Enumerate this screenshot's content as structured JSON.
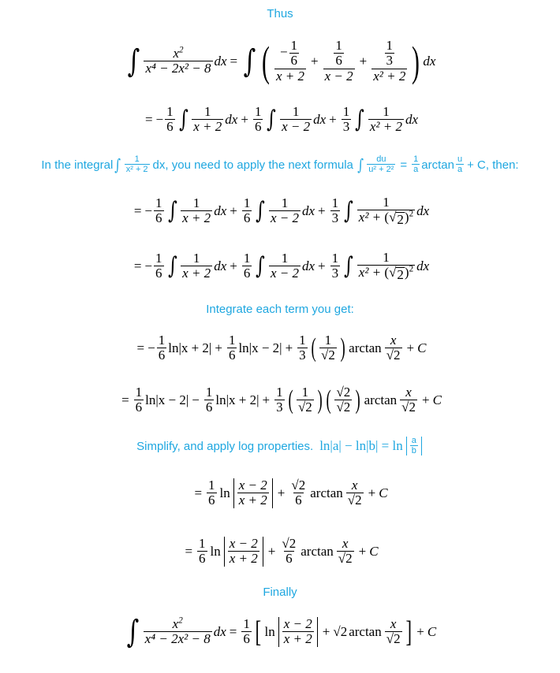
{
  "colors": {
    "note": "#1fa7e0",
    "math": "#000000",
    "background": "#ffffff"
  },
  "notes": {
    "thus": "Thus",
    "in_the_integral": "In the integral",
    "dx_apply": "dx, you need to apply the next formula",
    "then": "+ C, then:",
    "integrate_each": "Integrate each term you get:",
    "simplify": "Simplify, and apply log properties.",
    "finally": "Finally"
  },
  "sym": {
    "int": "∫",
    "eq": "=",
    "plus": "+",
    "minus": "−",
    "lparen": "(",
    "rparen": ")",
    "lbrack": "[",
    "rbrack": "]",
    "sqrt": "√",
    "one": "1",
    "two": "2",
    "three": "3",
    "six": "6",
    "x": "x",
    "dx": "dx",
    "du": "du",
    "ln": "ln",
    "arctan": "arctan",
    "C": "C",
    "a": "a",
    "u": "u",
    "b": "b",
    "sq": "2",
    "four": "4"
  },
  "expr": {
    "x2": "x",
    "poly_den": "x⁴ − 2x² − 8",
    "x_plus_2": "x + 2",
    "x_minus_2": "x − 2",
    "x2_plus_2": "x² + 2",
    "x2_plus_sqrt2": "x² + ",
    "u2_22": "u² + 2²",
    "x2p2_small": "x² + 2",
    "ln_abs_xp2": "ln|x + 2|",
    "ln_abs_xm2": "ln|x − 2|",
    "ln_a_minus_ln_b": "ln|a| − ln|b| = ln",
    "neg_one": "−1"
  }
}
